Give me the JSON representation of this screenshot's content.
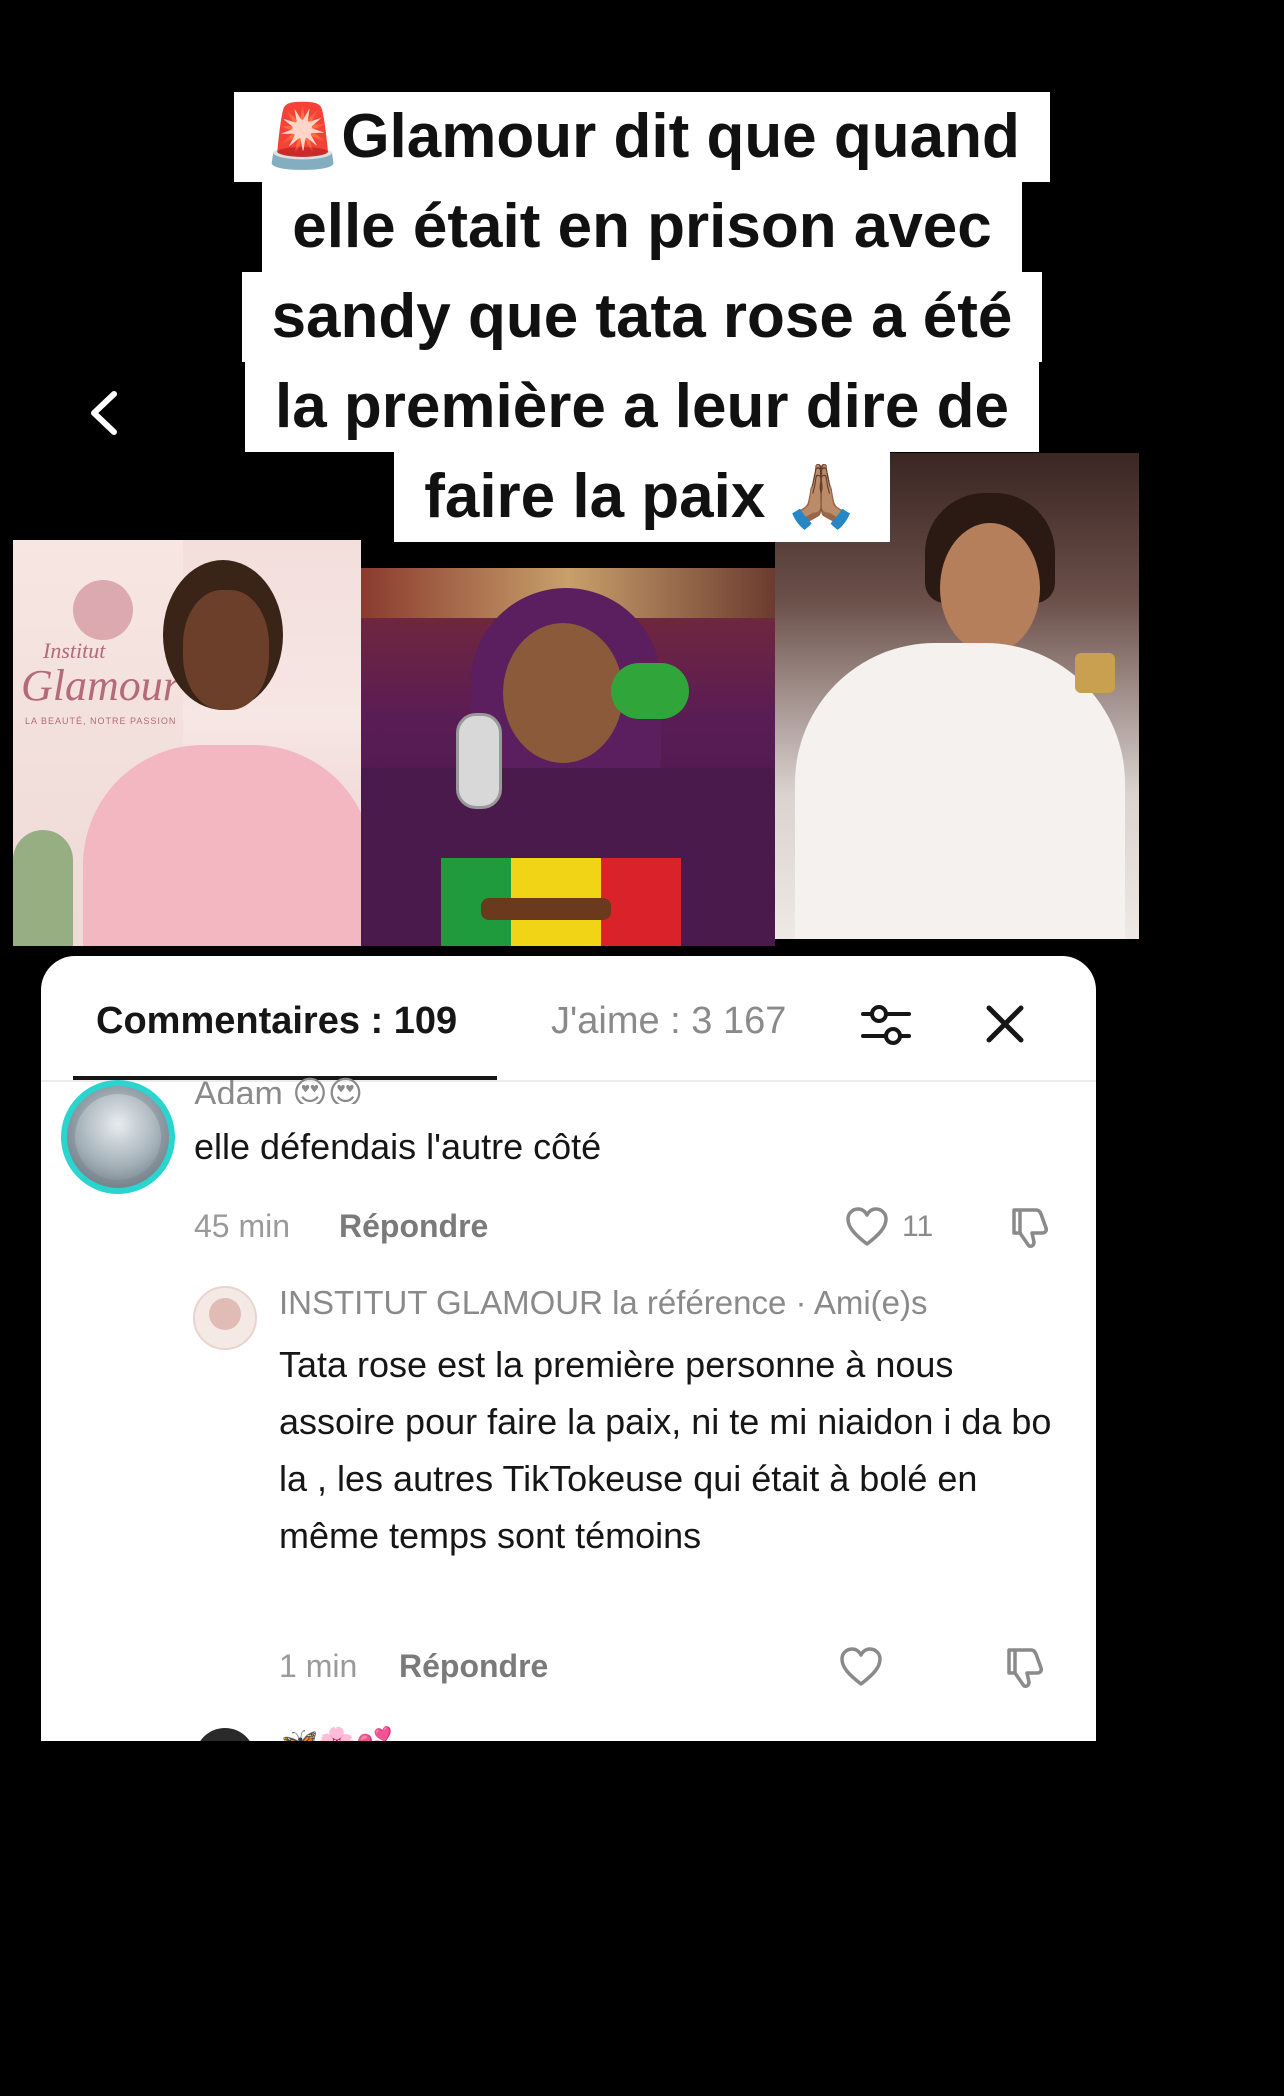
{
  "caption": {
    "lines": [
      "Glamour dit que quand",
      "elle était en prison avec",
      "sandy que tata rose a été",
      "la première a leur dire de",
      "faire la paix"
    ],
    "lead_emoji": "🚨",
    "trail_emoji": "🙏🏽"
  },
  "collage": {
    "left_brand": "Institut",
    "left_brand_name": "Glamour",
    "left_brand_tagline": "LA BEAUTÉ, NOTRE PASSION"
  },
  "comments_panel": {
    "tab_comments": "Commentaires : 109",
    "tab_likes": "J'aime : 3 167",
    "comments": [
      {
        "author": "Adam 😍😍",
        "text": "elle défendais l'autre côté",
        "time": "45 min",
        "reply_label": "Répondre",
        "likes": "11"
      },
      {
        "author": "INSTITUT GLAMOUR la référence · Ami(e)s",
        "text": "Tata rose est la première personne à nous assoire pour faire la paix, ni te mi niaidon i da bo la , les autres TikTokeuse qui était à bolé en même temps sont témoins",
        "time": "1 min",
        "reply_label": "Répondre",
        "likes": ""
      }
    ],
    "next_author": "🦋🌸💕"
  },
  "colors": {
    "accent_ring": "#2ad4cf",
    "panel_bg": "#ffffff",
    "page_bg": "#000000"
  },
  "icons": [
    "chevron-left-icon",
    "filter-sliders-icon",
    "close-icon",
    "heart-icon",
    "dislike-icon"
  ]
}
